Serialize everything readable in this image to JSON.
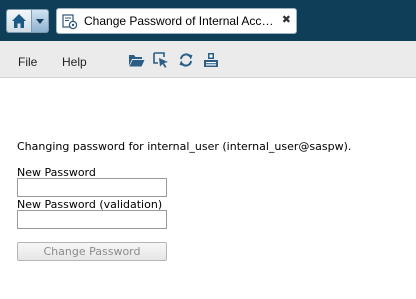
{
  "header": {
    "tab_title": "Change Password of Internal Account",
    "icons": {
      "home": "home-icon",
      "home_menu": "chevron-down-icon",
      "tab": "account-settings-icon",
      "close": "close-icon"
    },
    "colors": {
      "bar": "#0f3e58",
      "home_menu_btn": "#8fb2cf"
    }
  },
  "menubar": {
    "items": [
      {
        "label": "File"
      },
      {
        "label": "Help"
      }
    ],
    "tools": [
      "open-folder-icon",
      "select-icon",
      "refresh-icon",
      "save-icon"
    ]
  },
  "form": {
    "message": "Changing password for internal_user (internal_user@saspw).",
    "new_password_label": "New Password",
    "new_password_value": "",
    "validation_label": "New Password (validation)",
    "validation_value": "",
    "submit_label": "Change Password"
  }
}
